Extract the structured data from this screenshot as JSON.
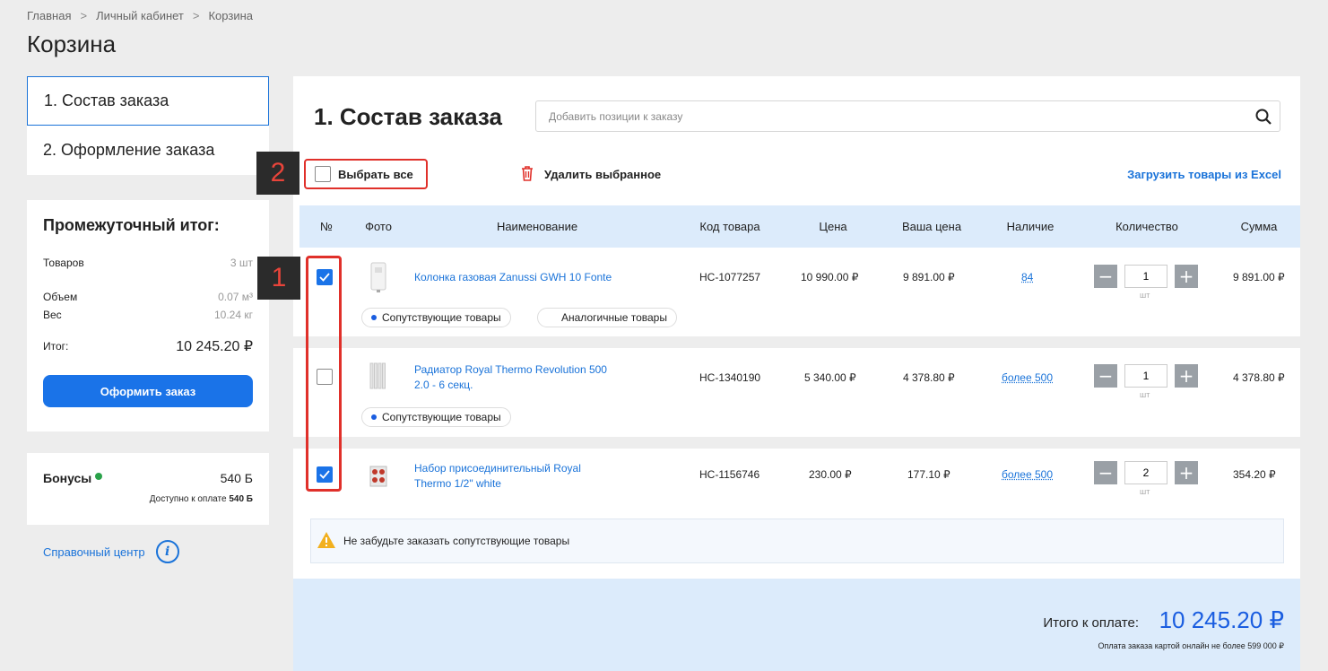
{
  "breadcrumb": [
    "Главная",
    "Личный кабинет",
    "Корзина"
  ],
  "breadcrumb_sep": ">",
  "page_title": "Корзина",
  "steps": [
    "1. Состав заказа",
    "2. Оформление заказа"
  ],
  "summary": {
    "title": "Промежуточный итог:",
    "items_label": "Товаров",
    "items_value": "3 шт",
    "volume_label": "Объем",
    "volume_value": "0.07 м³",
    "weight_label": "Вес",
    "weight_value": "10.24 кг",
    "total_label": "Итог:",
    "total_value": "10 245.20 ₽",
    "checkout_button": "Оформить заказ"
  },
  "bonus": {
    "label": "Бонусы",
    "value": "540 Б",
    "available_text": "Доступно к оплате",
    "available_value": "540 Б"
  },
  "help_center": "Справочный центр",
  "main": {
    "title": "1. Состав заказа",
    "search_placeholder": "Добавить позиции к заказу",
    "select_all": "Выбрать все",
    "delete_selected": "Удалить выбранное",
    "upload_excel": "Загрузить товары из Excel"
  },
  "table": {
    "headers": [
      "№",
      "Фото",
      "Наименование",
      "Код товара",
      "Цена",
      "Ваша цена",
      "Наличие",
      "Количество",
      "Сумма"
    ],
    "unit": "шт",
    "rows": [
      {
        "checked": true,
        "name_line1": "Колонка газовая Zanussi GWH 10 Fonte",
        "name_line2": "",
        "code": "НС-1077257",
        "price": "10 990.00 ₽",
        "your_price": "9 891.00 ₽",
        "availability": "84",
        "quantity": "1",
        "sum": "9 891.00 ₽",
        "chips": [
          "Сопутствующие товары",
          "Аналогичные товары"
        ]
      },
      {
        "checked": false,
        "name_line1": "Радиатор Royal Thermo Revolution 500",
        "name_line2": "2.0 - 6 секц.",
        "code": "НС-1340190",
        "price": "5 340.00 ₽",
        "your_price": "4 378.80 ₽",
        "availability": "более 500",
        "quantity": "1",
        "sum": "4 378.80 ₽",
        "chips": [
          "Сопутствующие товары"
        ]
      },
      {
        "checked": true,
        "name_line1": "Набор присоединительный Royal",
        "name_line2": "Thermo 1/2\" white",
        "code": "НС-1156746",
        "price": "230.00 ₽",
        "your_price": "177.10 ₽",
        "availability": "более 500",
        "quantity": "2",
        "sum": "354.20 ₽",
        "chips": []
      }
    ]
  },
  "notice": "Не забудьте заказать сопутствующие товары",
  "footer": {
    "total_label": "Итого к оплате:",
    "total_value": "10 245.20 ₽",
    "note": "Оплата заказа картой онлайн не более 599 000 ₽"
  },
  "annotations": [
    "1",
    "2"
  ],
  "colors": {
    "accent": "#1a73e8",
    "link": "#1a73d9",
    "header_bg": "#dcebfb",
    "annotation_red": "#e0302a"
  }
}
